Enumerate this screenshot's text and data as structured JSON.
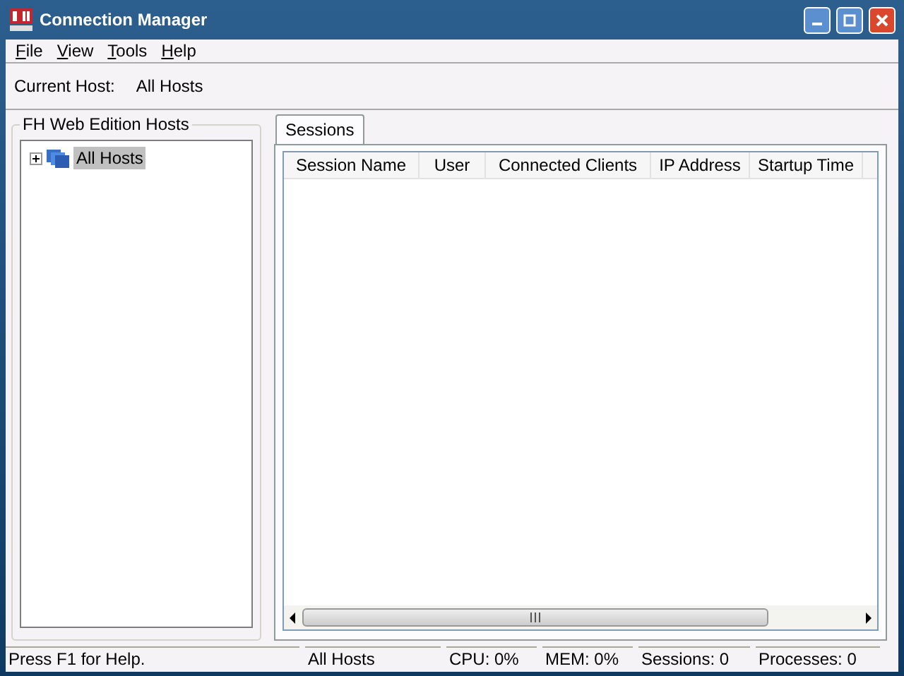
{
  "window": {
    "title": "Connection Manager"
  },
  "menu": [
    "File",
    "View",
    "Tools",
    "Help"
  ],
  "current_host": {
    "label": "Current Host:",
    "value": "All Hosts"
  },
  "hosts_group": {
    "title": "FH Web Edition Hosts",
    "tree": [
      {
        "label": "All Hosts",
        "selected": true,
        "expanded": false
      }
    ]
  },
  "tabs": [
    {
      "label": "Sessions",
      "selected": true
    }
  ],
  "table": {
    "columns": [
      "Session Name",
      "User",
      "Connected Clients",
      "IP Address",
      "Startup Time"
    ]
  },
  "status_bar": [
    "Press F1 for Help.",
    "All Hosts",
    "CPU: 0%",
    "MEM: 0%",
    "Sessions: 0",
    "Processes: 0"
  ]
}
